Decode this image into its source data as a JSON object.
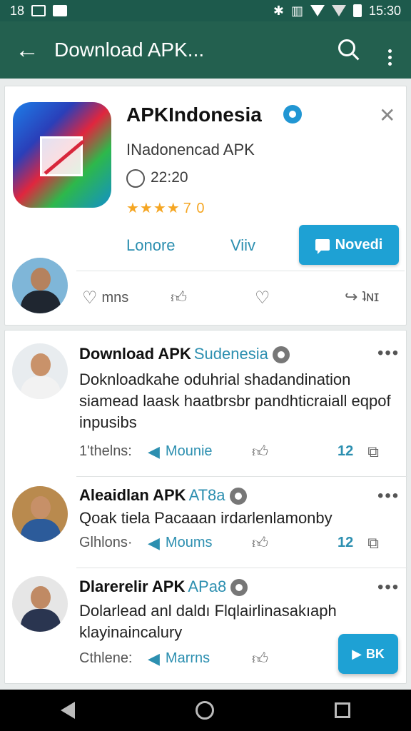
{
  "status_bar": {
    "left_text": "18",
    "time": "15:30"
  },
  "app_bar": {
    "title": "Download APK..."
  },
  "app_card": {
    "name": "APKIndonesia",
    "subtitle": "INadonencad APK",
    "meta": "22:20",
    "stars": "★★★★",
    "rating_text": "7 0",
    "link1": "Lonore",
    "link2": "Viiv",
    "primary_button": "Novedi",
    "actions": {
      "comment": "mns",
      "share": "ʇɴɪ"
    },
    "colors": {
      "accent": "#1ea1d4",
      "app_bar": "#23604f"
    }
  },
  "posts": [
    {
      "title": "Download APK",
      "tag": "Sudenesia",
      "body": "Doknloadkahe oduhrial shadandination siamead laask haatbrsbr pandhticraiall eqpof inpusibs",
      "time": "1'thelns:",
      "share_label": "Mounie",
      "count": "12"
    },
    {
      "title": "Aleaidlan APK",
      "tag": "AT8a",
      "body": "Qoak tiela Pacaaan irdarlenlamonby",
      "time": "Glhlons·",
      "share_label": "Moums",
      "count": "12"
    },
    {
      "title": "Dlarerelir APK",
      "tag": "APa8",
      "body": "Dolarlead anl daldı Flqlairlinasakıaph klayinaincalury",
      "time": "Cthlene:",
      "share_label": "Marrns",
      "count": ""
    }
  ],
  "fab": {
    "label": "BK"
  }
}
